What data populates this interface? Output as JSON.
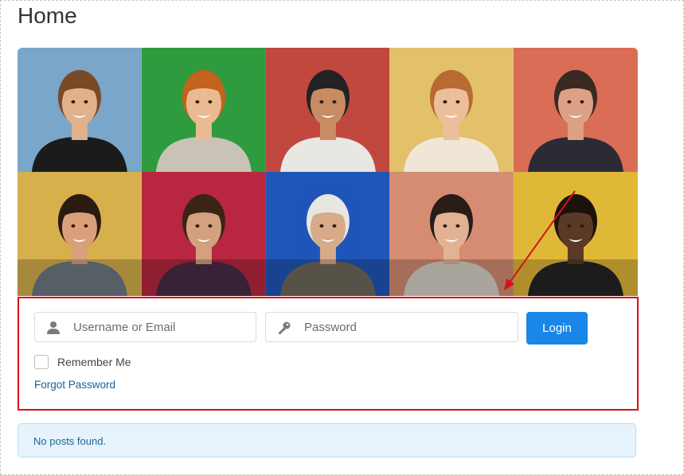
{
  "page": {
    "title": "Home"
  },
  "hero": {
    "tiles": [
      {
        "bg": "#7aa6c9",
        "skin": "#e2b08a",
        "hair": "#7a4a26",
        "shirt": "#1b1b1b"
      },
      {
        "bg": "#2f9b3f",
        "skin": "#eabb92",
        "hair": "#c4621e",
        "shirt": "#c9c2b6"
      },
      {
        "bg": "#c0483f",
        "skin": "#c98b63",
        "hair": "#222222",
        "shirt": "#e9e7e2"
      },
      {
        "bg": "#e3c06a",
        "skin": "#ecbf9b",
        "hair": "#b96a33",
        "shirt": "#efe6d6"
      },
      {
        "bg": "#d96d55",
        "skin": "#dca184",
        "hair": "#3a2a22",
        "shirt": "#2a2b35"
      },
      {
        "bg": "#d7b04d",
        "skin": "#d9a07a",
        "hair": "#2b1b13",
        "shirt": "#6d7a82"
      },
      {
        "bg": "#b8273f",
        "skin": "#d3a080",
        "hair": "#3a2418",
        "shirt": "#4a2c44"
      },
      {
        "bg": "#1f56b8",
        "skin": "#d7aa88",
        "hair": "#e8e6e1",
        "shirt": "#6f6a5c"
      },
      {
        "bg": "#d58d73",
        "skin": "#e1b294",
        "hair": "#2a1c16",
        "shirt": "#d9d2c8"
      },
      {
        "bg": "#e0b838",
        "skin": "#5a3a26",
        "hair": "#1c120d",
        "shirt": "#242424"
      }
    ]
  },
  "login": {
    "username_placeholder": "Username or Email",
    "password_placeholder": "Password",
    "login_label": "Login",
    "remember_label": "Remember Me",
    "forgot_label": "Forgot Password",
    "accent": "#1a86e8",
    "highlight_border": "#d6111b"
  },
  "notice": {
    "text": "No posts found."
  }
}
